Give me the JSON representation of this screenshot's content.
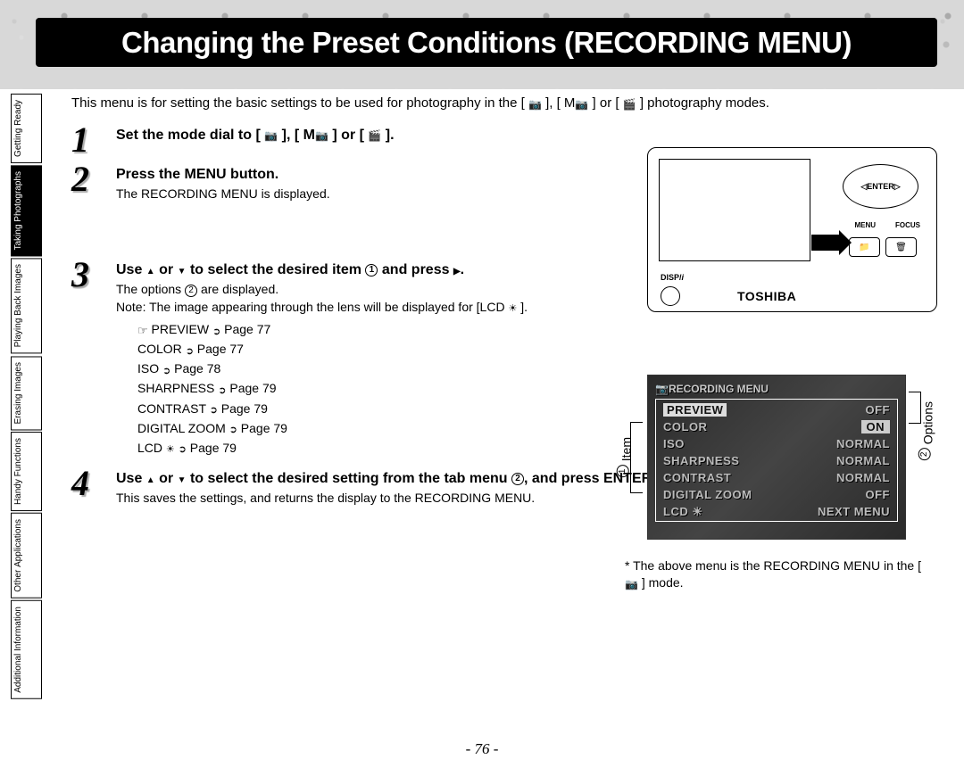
{
  "title": "Changing the Preset Conditions (RECORDING MENU)",
  "intro_pre": "This menu is for setting the basic settings to be used for photography in the [ ",
  "intro_mid1": " ], [ M",
  "intro_mid2": " ] or [ ",
  "intro_post": " ] photography modes.",
  "sidebar": {
    "tabs": [
      {
        "l1": "Getting",
        "l2": "Ready"
      },
      {
        "l1": "Taking",
        "l2": "Photographs"
      },
      {
        "l1": "Playing",
        "l2": "Back Images"
      },
      {
        "l1": "Erasing",
        "l2": "Images"
      },
      {
        "l1": "Handy",
        "l2": "Functions"
      },
      {
        "l1": "Other",
        "l2": "Applications"
      },
      {
        "l1": "Additional",
        "l2": "Information"
      }
    ]
  },
  "steps": {
    "s1": {
      "num": "1",
      "title_pre": "Set the mode dial to [ ",
      "title_mid1": " ], [ M",
      "title_mid2": " ] or [ ",
      "title_post": " ]."
    },
    "s2": {
      "num": "2",
      "title": "Press the MENU button.",
      "desc": "The RECORDING MENU is displayed."
    },
    "s3": {
      "num": "3",
      "title_pre": "Use ",
      "title_mid": " or ",
      "title_mid2": " to select the desired item ",
      "title_mid3": " and press ",
      "title_post": ".",
      "desc_pre": "The options ",
      "desc_post": " are displayed.",
      "note_pre": "Note: The image appearing through the lens will be displayed for [LCD ",
      "note_post": " ].",
      "refs": [
        {
          "label": "PREVIEW",
          "page": "Page 77"
        },
        {
          "label": "COLOR",
          "page": "Page 77"
        },
        {
          "label": "ISO",
          "page": "Page 78"
        },
        {
          "label": "SHARPNESS",
          "page": "Page 79"
        },
        {
          "label": "CONTRAST",
          "page": "Page 79"
        },
        {
          "label": "DIGITAL ZOOM",
          "page": "Page 79"
        },
        {
          "label": "LCD",
          "page": "Page 79",
          "icon": "bright"
        }
      ]
    },
    "s4": {
      "num": "4",
      "title_pre": "Use ",
      "title_mid": " or ",
      "title_mid2": " to select the desired setting from the tab menu ",
      "title_mid3": ", and press ENTER.",
      "desc": "This saves the settings, and returns the display to the RECORDING MENU."
    }
  },
  "camera": {
    "enter": "ENTER",
    "menu": "MENU",
    "focus": "FOCUS",
    "disp": "DISP/",
    "brand": "TOSHIBA"
  },
  "menu": {
    "title": "RECORDING MENU",
    "rows": [
      {
        "k": "PREVIEW",
        "v": "OFF",
        "ksel": true
      },
      {
        "k": "COLOR",
        "v": "ON",
        "vsel": true
      },
      {
        "k": "ISO",
        "v": "NORMAL"
      },
      {
        "k": "SHARPNESS",
        "v": "NORMAL"
      },
      {
        "k": "CONTRAST",
        "v": "NORMAL"
      },
      {
        "k": "DIGITAL ZOOM",
        "v": "OFF"
      },
      {
        "k": "LCD ☀",
        "v": "NEXT MENU"
      }
    ],
    "note_pre": "* The above menu is the RECORDING MENU in the [ ",
    "note_post": " ] mode."
  },
  "labels": {
    "item_pre": "Item",
    "options_pre": "Options",
    "circ1": "1",
    "circ2": "2"
  },
  "page": "- 76 -"
}
